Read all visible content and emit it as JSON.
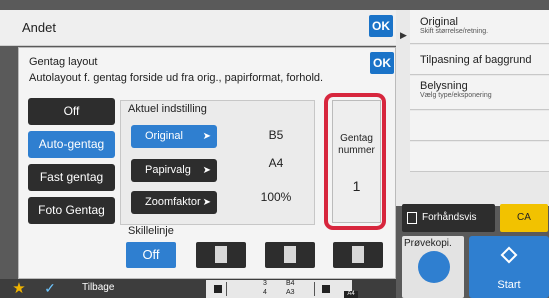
{
  "colors": {
    "accent_blue": "#2f7fd0",
    "ok_blue": "#1a73c8",
    "dark_button": "#2d2d2d",
    "highlight_red": "#d7263d",
    "ca_yellow": "#f2c200"
  },
  "header": {
    "title": "Andet",
    "ok_label": "OK"
  },
  "dialog": {
    "title": "Gentag layout",
    "description": "Autolayout f. gentag forside ud fra orig., papirformat, forhold.",
    "ok_label": "OK",
    "mode_buttons": [
      {
        "label": "Off",
        "active": false
      },
      {
        "label": "Auto-gentag",
        "active": true
      },
      {
        "label": "Fast gentag",
        "active": false
      },
      {
        "label": "Foto Gentag",
        "active": false
      }
    ],
    "current_settings": {
      "title": "Aktuel indstilling",
      "rows": [
        {
          "label": "Original",
          "value": "B5",
          "active": true
        },
        {
          "label": "Papirvalg",
          "value": "A4",
          "active": false
        },
        {
          "label": "Zoomfaktor",
          "value": "100%",
          "active": false
        }
      ]
    },
    "repeat_number": {
      "label_line1": "Gentag",
      "label_line2": "nummer",
      "value": "1"
    },
    "divider": {
      "label": "Skillelinje",
      "off_label": "Off"
    }
  },
  "right_panel": {
    "items": [
      {
        "title": "Original",
        "subtitle": "Skift størrelse/retning."
      },
      {
        "title": "Tilpasning af baggrund",
        "subtitle": ""
      },
      {
        "title": "Belysning",
        "subtitle": "Vælg type/eksponering"
      }
    ],
    "preview_label": "Forhåndsvis",
    "ca_label": "CA",
    "sample_copy_label": "Prøvekopi.",
    "start_label": "Start"
  },
  "bottom_bar": {
    "back_label": "Tilbage",
    "tray1_top": "3",
    "tray1_top_size": "B4",
    "tray1_bottom": "4",
    "tray1_bottom_size": "A3",
    "selected_paper": "A4"
  },
  "icons": [
    "star-icon",
    "checkmark-icon",
    "arrow-right-icon",
    "page-icon",
    "preview-icon",
    "start-diamond-icon",
    "play-icon"
  ]
}
